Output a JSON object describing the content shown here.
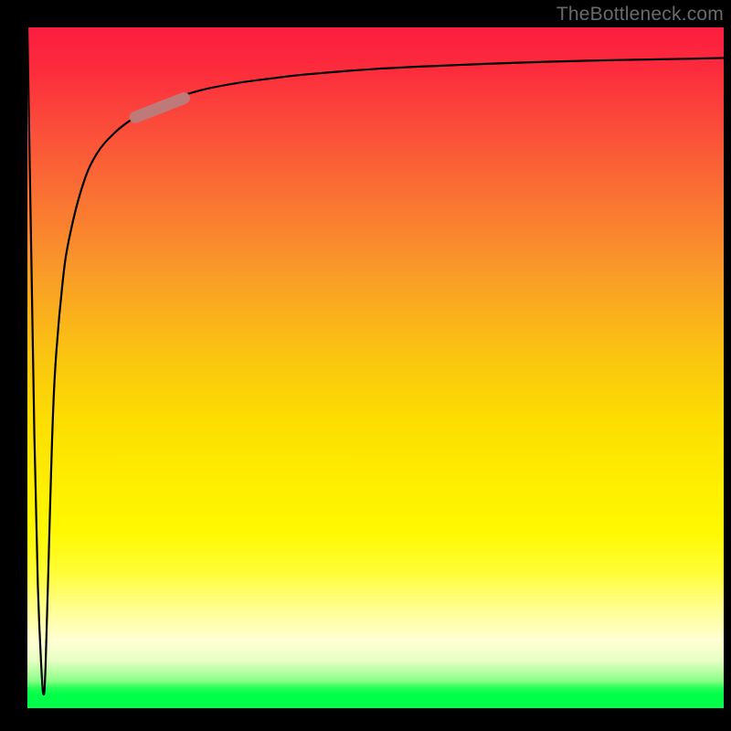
{
  "watermark": {
    "text": "TheBottleneck.com"
  },
  "chart_data": {
    "type": "line",
    "title": "",
    "xlabel": "",
    "ylabel": "",
    "xlim": [
      0,
      100
    ],
    "ylim": [
      0,
      100
    ],
    "grid": false,
    "legend": false,
    "series": [
      {
        "name": "bottleneck-curve",
        "x": [
          0.0,
          0.5,
          1.0,
          1.5,
          2.0,
          2.33,
          2.6,
          3.0,
          3.5,
          4.0,
          5.0,
          6.0,
          8.0,
          10.0,
          12.5,
          15.0,
          17.5,
          20.0,
          25.0,
          30.0,
          35.0,
          40.0,
          50.0,
          60.0,
          70.0,
          80.0,
          90.0,
          100.0
        ],
        "y": [
          100.0,
          70.0,
          40.0,
          18.0,
          6.0,
          2.0,
          6.0,
          20.0,
          38.0,
          50.0,
          62.0,
          69.0,
          77.0,
          81.5,
          84.5,
          86.5,
          88.0,
          89.2,
          90.8,
          91.8,
          92.5,
          93.1,
          93.9,
          94.4,
          94.8,
          95.1,
          95.3,
          95.5
        ]
      },
      {
        "name": "highlight-segment",
        "x": [
          15.5,
          22.5
        ],
        "y": [
          86.8,
          89.6
        ]
      }
    ],
    "gradient_stops": [
      {
        "pos": 0,
        "color": "#fc1d3e"
      },
      {
        "pos": 24,
        "color": "#fa6f34"
      },
      {
        "pos": 48,
        "color": "#fac411"
      },
      {
        "pos": 74,
        "color": "#fff800"
      },
      {
        "pos": 93,
        "color": "#e7ffc4"
      },
      {
        "pos": 100,
        "color": "#00ff48"
      }
    ]
  }
}
